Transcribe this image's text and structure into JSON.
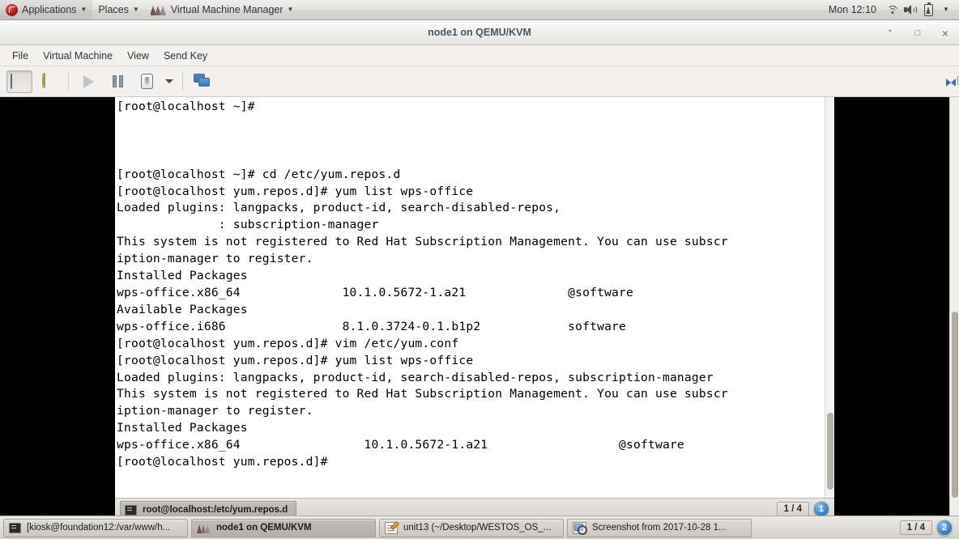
{
  "top_panel": {
    "logo_icon": "fedora-logo-icon",
    "applications_label": "Applications",
    "places_label": "Places",
    "app_menu_label": "Virtual Machine Manager",
    "app_menu_icon": "virtual-machine-manager-icon",
    "clock": "Mon 12:10",
    "tray": {
      "wifi_icon": "wifi-icon",
      "volume_icon": "volume-icon",
      "battery_icon": "battery-charging-icon",
      "menu_caret": "chevron-down-icon"
    }
  },
  "window": {
    "title": "node1 on QEMU/KVM",
    "minimize_label": "-",
    "maximize_label": "□",
    "close_label": "×"
  },
  "menubar": {
    "items": [
      {
        "label": "File"
      },
      {
        "label": "Virtual Machine"
      },
      {
        "label": "View"
      },
      {
        "label": "Send Key"
      }
    ]
  },
  "toolbar": {
    "buttons": [
      {
        "name": "show-console-button",
        "icon": "monitor-icon",
        "state": "pressed",
        "enabled": true
      },
      {
        "name": "show-details-button",
        "icon": "lightbulb-icon",
        "state": "normal",
        "enabled": true
      },
      {
        "name": "run-button",
        "icon": "play-icon",
        "state": "normal",
        "enabled": false
      },
      {
        "name": "pause-button",
        "icon": "pause-icon",
        "state": "normal",
        "enabled": true
      },
      {
        "name": "shutdown-button",
        "icon": "power-switch-icon",
        "state": "normal",
        "enabled": true
      },
      {
        "name": "shutdown-menu-button",
        "icon": "chevron-down-icon",
        "state": "normal",
        "enabled": true
      },
      {
        "name": "snapshots-button",
        "icon": "multi-monitor-icon",
        "state": "normal",
        "enabled": true
      }
    ],
    "resize_button": {
      "name": "resize-to-vm-button",
      "icon": "resize-arrows-icon"
    }
  },
  "guest": {
    "terminal": {
      "lines": [
        "[root@localhost ~]#",
        "",
        "",
        "",
        "[root@localhost ~]# cd /etc/yum.repos.d",
        "[root@localhost yum.repos.d]# yum list wps-office",
        "Loaded plugins: langpacks, product-id, search-disabled-repos,",
        "              : subscription-manager",
        "This system is not registered to Red Hat Subscription Management. You can use subscr",
        "iption-manager to register.",
        "Installed Packages",
        "wps-office.x86_64              10.1.0.5672-1.a21              @software",
        "Available Packages",
        "wps-office.i686                8.1.0.3724-0.1.b1p2            software",
        "[root@localhost yum.repos.d]# vim /etc/yum.conf",
        "[root@localhost yum.repos.d]# yum list wps-office",
        "Loaded plugins: langpacks, product-id, search-disabled-repos, subscription-manager",
        "This system is not registered to Red Hat Subscription Management. You can use subscr",
        "iption-manager to register.",
        "Installed Packages",
        "wps-office.x86_64                 10.1.0.5672-1.a21                  @software",
        "[root@localhost yum.repos.d]#"
      ],
      "statusbar": {
        "task_icon": "terminal-icon",
        "task_label": "root@localhost:/etc/yum.repos.d",
        "workspace_count": "1 / 4",
        "workspace_badge": "1"
      }
    }
  },
  "bottom_panel": {
    "tasks": [
      {
        "icon": "terminal-icon",
        "label": "[kiosk@foundation12:/var/www/h...",
        "active": false
      },
      {
        "icon": "virtual-machine-manager-icon",
        "label": "node1 on QEMU/KVM",
        "active": true
      },
      {
        "icon": "text-editor-icon",
        "label": "unit13 (~/Desktop/WESTOS_OS_...",
        "active": false
      },
      {
        "icon": "screenshot-icon",
        "label": "Screenshot from 2017-10-28 1...",
        "active": false
      }
    ],
    "workspace_count": "1 / 4",
    "workspace_badge": "2"
  },
  "colors": {
    "panel_bg": "#e3e2e0",
    "window_bg": "#f2f1f0",
    "title_text": "#4a5560",
    "terminal_bg": "#ffffff",
    "terminal_fg": "#000000",
    "guest_bg": "#000000",
    "badge_blue": "#3c82c4"
  }
}
